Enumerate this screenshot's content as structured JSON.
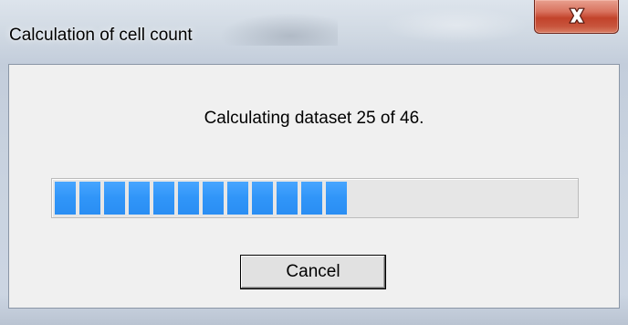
{
  "window": {
    "title": "Calculation of cell count",
    "close_icon": "close-x-icon"
  },
  "dialog": {
    "status_text": "Calculating dataset 25 of 46.",
    "progress": {
      "current": 25,
      "total": 46,
      "fraction_filled": 0.543,
      "segment_color": "#3399ff"
    },
    "cancel_label": "Cancel"
  },
  "colors": {
    "close_button": "#c8553c",
    "client_background": "#f0f0f0",
    "progress_fill": "#3399ff"
  }
}
